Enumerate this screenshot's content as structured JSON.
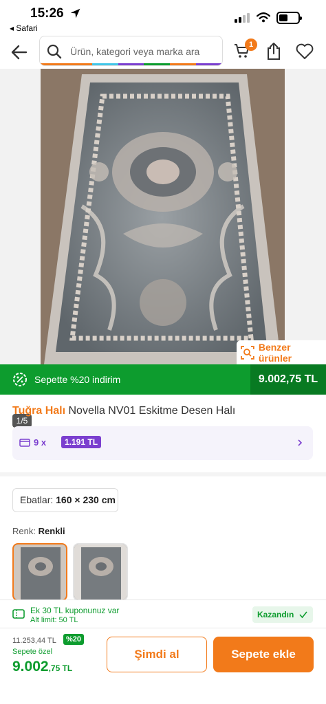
{
  "status": {
    "time": "15:26",
    "back_app": "◂ Safari"
  },
  "header": {
    "search_placeholder": "Ürün, kategori veya marka ara",
    "cart_count": "1"
  },
  "gallery": {
    "counter": "1/5",
    "similar_label": "Benzer ürünler"
  },
  "promo": {
    "text": "Sepette %20 indirim",
    "price": "9.002,75 TL"
  },
  "product": {
    "brand": "Tuğra Halı",
    "name": "Novella NV01 Eskitme Desen Halı"
  },
  "installment": {
    "count": "9 x",
    "amount": "1.191 TL"
  },
  "size": {
    "label": "Ebatlar:",
    "value": "160 × 230 cm"
  },
  "color": {
    "label": "Renk:",
    "value": "Renkli"
  },
  "coupon": {
    "line1": "Ek 30 TL kuponunuz var",
    "line2": "Alt limit: 50 TL",
    "action": "Kazandın"
  },
  "footer": {
    "old_price": "11.253,44 TL",
    "discount": "%20",
    "special_label": "Sepete özel",
    "price_main": "9.002",
    "price_cents": ",75 TL",
    "buy_now": "Şimdi al",
    "add_to_cart": "Sepete ekle"
  },
  "colors": {
    "accent": "#f27a1a",
    "green": "#0d9c2e",
    "purple": "#7b3fcf"
  },
  "icons": [
    "location-arrow-icon",
    "signal-icon",
    "wifi-icon",
    "battery-icon",
    "back-arrow-icon",
    "search-icon",
    "cart-icon",
    "share-icon",
    "heart-icon",
    "image-search-icon",
    "discount-badge-icon",
    "card-icon",
    "chevron-right-icon",
    "coupon-icon",
    "check-icon"
  ]
}
